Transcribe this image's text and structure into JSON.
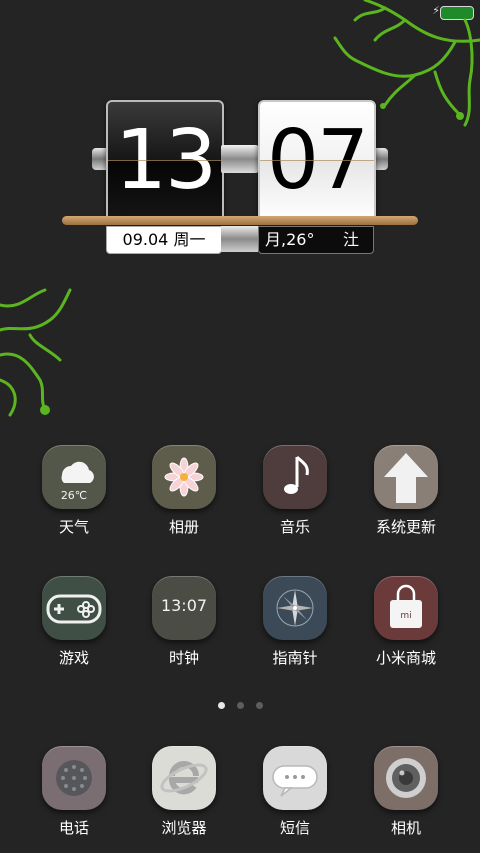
{
  "status_bar": {
    "battery_color": "#1f8a2a",
    "charging_icon": "bolt-icon"
  },
  "clock_widget": {
    "hours": "13",
    "minutes": "07",
    "date": "09.04 周一",
    "weather": "月,26°",
    "weather_end": "汢"
  },
  "apps_page": [
    {
      "name": "weather",
      "label": "天气",
      "icon": "cloud-icon",
      "tile_color": "#52574a",
      "extra": "26℃"
    },
    {
      "name": "gallery",
      "label": "相册",
      "icon": "flower-icon",
      "tile_color": "#5e5d4c"
    },
    {
      "name": "music",
      "label": "音乐",
      "icon": "music-note-icon",
      "tile_color": "#4f3d3d"
    },
    {
      "name": "updater",
      "label": "系统更新",
      "icon": "arrow-up-icon",
      "tile_color": "#8a7f77"
    },
    {
      "name": "games",
      "label": "游戏",
      "icon": "gamepad-icon",
      "tile_color": "#3f4f46"
    },
    {
      "name": "clock",
      "label": "时钟",
      "icon": "clock-icon",
      "tile_color": "#4b4d45",
      "extra": "13:07"
    },
    {
      "name": "compass",
      "label": "指南针",
      "icon": "compass-icon",
      "tile_color": "#3c4a57"
    },
    {
      "name": "mi-store",
      "label": "小米商城",
      "icon": "shopping-bag-icon",
      "tile_color": "#6b3b3b",
      "extra": "mi"
    }
  ],
  "page_indicator": {
    "count": 3,
    "active": 0
  },
  "dock": [
    {
      "name": "phone",
      "label": "电话",
      "icon": "phone-dial-icon",
      "tile_color": "#7a6e72"
    },
    {
      "name": "browser",
      "label": "浏览器",
      "icon": "browser-e-icon",
      "tile_color": "#dcdcd6"
    },
    {
      "name": "messages",
      "label": "短信",
      "icon": "speech-bubble-icon",
      "tile_color": "#d9d9d9"
    },
    {
      "name": "camera",
      "label": "相机",
      "icon": "camera-lens-icon",
      "tile_color": "#7d6e68"
    }
  ]
}
